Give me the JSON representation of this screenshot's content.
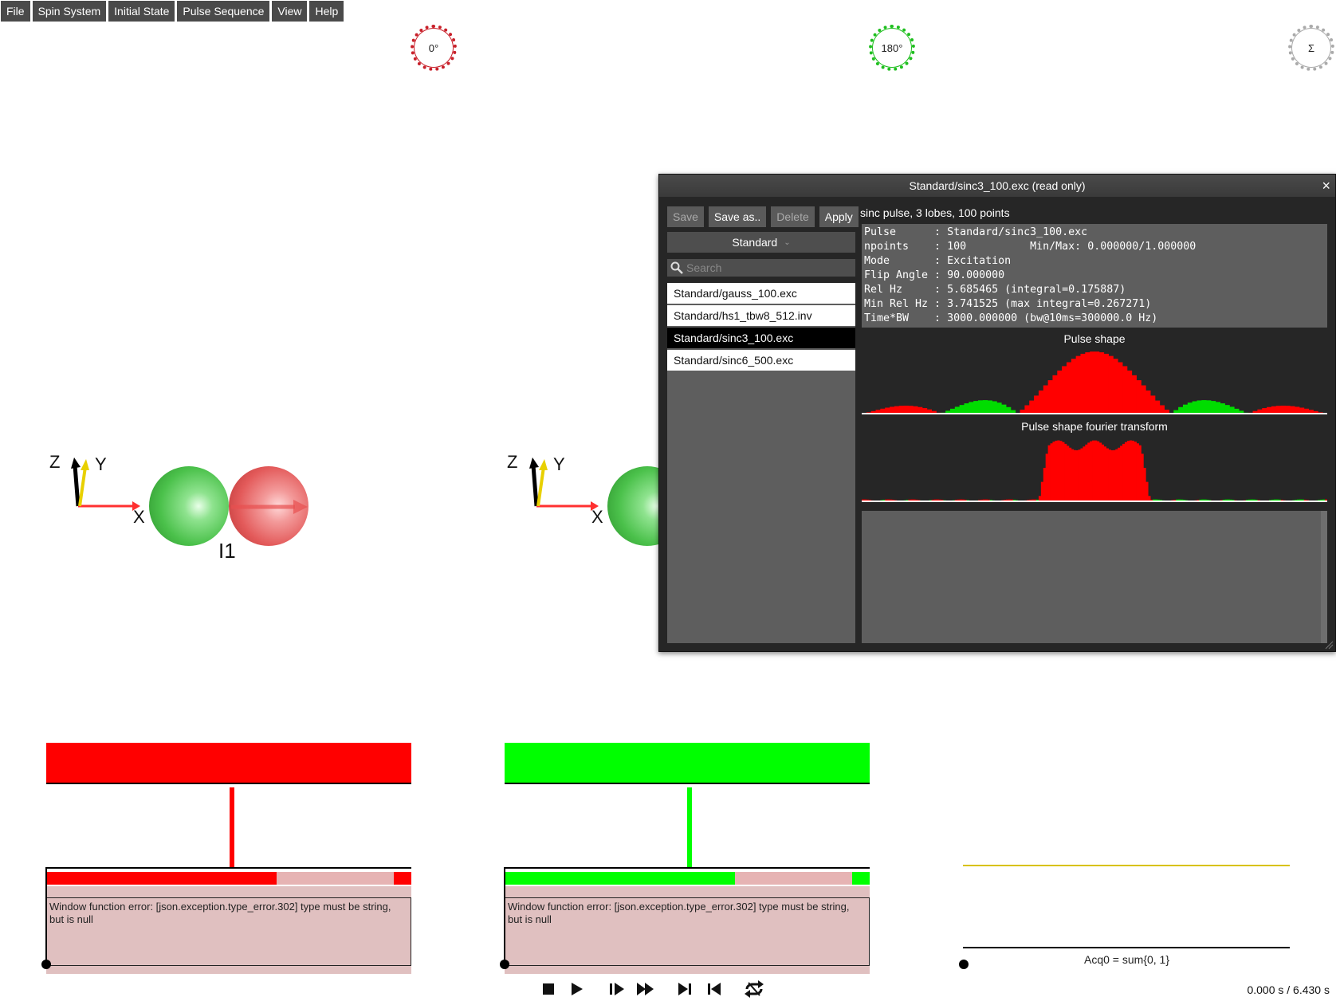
{
  "menu": [
    "File",
    "Spin System",
    "Initial State",
    "Pulse Sequence",
    "View",
    "Help"
  ],
  "dials": [
    {
      "label": "0°"
    },
    {
      "label": "180°"
    },
    {
      "label": "Σ"
    }
  ],
  "scene": {
    "axis_z": "Z",
    "axis_y": "Y",
    "axis_x": "X",
    "spin_label": "I1"
  },
  "channels": [
    {
      "error": "Window function error: [json.exception.type_error.302] type must be string, but is null",
      "color": "#ff0000",
      "progress": 0.63
    },
    {
      "error": "Window function error: [json.exception.type_error.302] type must be string, but is null",
      "color": "#00ff00",
      "progress": 0.63
    }
  ],
  "acquisition": {
    "label": "Acq0 = sum{0, 1}"
  },
  "transport": {
    "buttons": [
      "stop-icon",
      "play-icon",
      "step-forward-icon",
      "fast-forward-icon",
      "skip-to-end-icon",
      "skip-to-start-icon",
      "loop-icon"
    ],
    "time": "0.000 s / 6.430 s"
  },
  "dialog": {
    "title": "Standard/sinc3_100.exc (read only)",
    "close": "×",
    "buttons": {
      "save": "Save",
      "save_as": "Save as..",
      "delete": "Delete",
      "apply": "Apply"
    },
    "description": "sinc pulse, 3 lobes, 100 points",
    "library": "Standard",
    "search_placeholder": "Search",
    "files": [
      "Standard/gauss_100.exc",
      "Standard/hs1_tbw8_512.inv",
      "Standard/sinc3_100.exc",
      "Standard/sinc6_500.exc"
    ],
    "selected_file": 2,
    "info": {
      "line1": "Pulse      : Standard/sinc3_100.exc",
      "line2": "npoints    : 100          Min/Max: 0.000000/1.000000",
      "line3": "Mode       : Excitation",
      "line4": "Flip Angle : 90.000000",
      "line5": "Rel Hz     : 5.685465 (integral=0.175887)",
      "line6": "Min Rel Hz : 3.741525 (max integral=0.267271)",
      "line7": "Time*BW    : 3000.000000 (bw@10ms=300000.0 Hz)"
    },
    "plot1_title": "Pulse shape",
    "plot2_title": "Pulse shape fourier transform"
  }
}
